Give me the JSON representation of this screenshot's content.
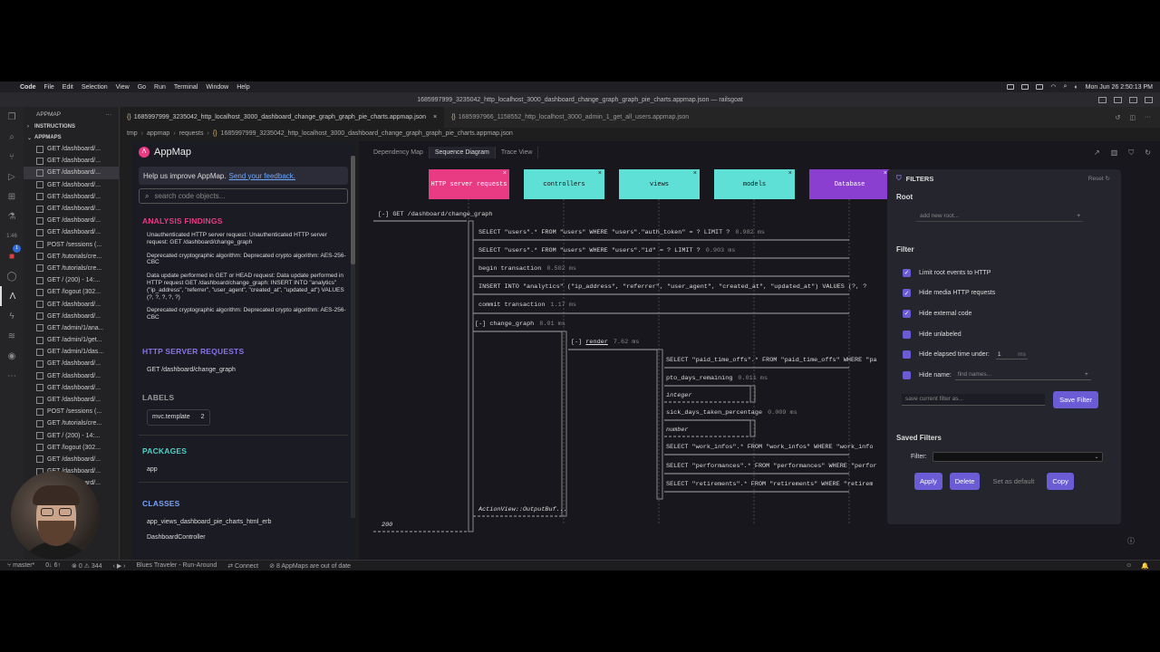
{
  "menubar": {
    "app": "Code",
    "items": [
      "File",
      "Edit",
      "Selection",
      "View",
      "Go",
      "Run",
      "Terminal",
      "Window",
      "Help"
    ],
    "clock": "Mon Jun 26  2:50:13 PM"
  },
  "window_title": "1685997999_3235042_http_localhost_3000_dashboard_change_graph_graph_pie_charts.appmap.json — railsgoat",
  "explorer": {
    "header": "APPMAP",
    "sections": [
      "INSTRUCTIONS",
      "APPMAPS"
    ],
    "items": [
      "GET /dashboard/...",
      "GET /dashboard/...",
      "GET /dashboard/...",
      "GET /dashboard/...",
      "GET /dashboard/...",
      "GET /dashboard/...",
      "GET /dashboard/...",
      "GET /dashboard/...",
      "POST /sessions (...",
      "GET /tutorials/cre...",
      "GET /tutorials/cre...",
      "GET / (200) - 14:...",
      "GET /logout (302...",
      "GET /dashboard/...",
      "GET /dashboard/...",
      "GET /admin/1/ana...",
      "GET /admin/1/get...",
      "GET /admin/1/das...",
      "GET /dashboard/...",
      "GET /dashboard/...",
      "GET /dashboard/...",
      "GET /dashboard/...",
      "POST /sessions (...",
      "GET /tutorials/cre...",
      "GET / (200) - 14:...",
      "GET /logout (302...",
      "GET /dashboard/...",
      "GET /dashboard/...",
      "GET /dashboard/..."
    ],
    "selected_index": 2
  },
  "activity": {
    "time_badge": "1:46",
    "badge_count": "1"
  },
  "tabs": [
    {
      "label": "1685997999_3235042_http_localhost_3000_dashboard_change_graph_graph_pie_charts.appmap.json",
      "active": true
    },
    {
      "label": "1685997966_1158552_http_localhost_3000_admin_1_get_all_users.appmap.json",
      "active": false
    }
  ],
  "breadcrumb": [
    "tmp",
    "appmap",
    "requests",
    "1685997999_3235042_http_localhost_3000_dashboard_change_graph_graph_pie_charts.appmap.json"
  ],
  "appmap_left": {
    "title": "AppMap",
    "improve_text": "Help us improve AppMap.",
    "improve_link": "Send your feedback.",
    "search_placeholder": "search code objects...",
    "analysis_header": "ANALYSIS FINDINGS",
    "findings": [
      "Unauthenticated HTTP server request: Unauthenticated HTTP server request: GET /dashboard/change_graph",
      "Deprecated cryptographic algorithm: Deprecated crypto algorithm: AES-256-CBC",
      "Data update performed in GET or HEAD request: Data update performed in HTTP request GET /dashboard/change_graph: INSERT INTO \"analytics\" (\"ip_address\", \"referrer\", \"user_agent\", \"created_at\", \"updated_at\") VALUES (?, ?, ?, ?, ?)",
      "Deprecated cryptographic algorithm: Deprecated crypto algorithm: AES-256-CBC"
    ],
    "http_header": "HTTP SERVER REQUESTS",
    "http_item": "GET /dashboard/change_graph",
    "labels_header": "LABELS",
    "label_name": "mvc.template",
    "label_count": "2",
    "packages_header": "PACKAGES",
    "package_item": "app",
    "classes_header": "CLASSES",
    "class_items": [
      "app_views_dashboard_pie_charts_html_erb",
      "DashboardController"
    ]
  },
  "subtabs": [
    "Dependency Map",
    "Sequence Diagram",
    "Trace View"
  ],
  "active_subtab": "Sequence Diagram",
  "actors": [
    {
      "label": "HTTP server requests",
      "color": "#e93a84"
    },
    {
      "label": "controllers",
      "color": "#5fe0d6"
    },
    {
      "label": "views",
      "color": "#5fe0d6"
    },
    {
      "label": "models",
      "color": "#5fe0d6"
    },
    {
      "label": "Database",
      "color": "#8a3fd0"
    }
  ],
  "sequence": {
    "root": "[-] GET /dashboard/change_graph",
    "messages": [
      {
        "text": "SELECT \"users\".* FROM \"users\" WHERE \"users\".\"auth_token\" = ? LIMIT ?",
        "time": "0.982 ms"
      },
      {
        "text": "SELECT \"users\".* FROM \"users\" WHERE \"users\".\"id\" = ? LIMIT ?",
        "time": "0.903 ms"
      },
      {
        "text": "begin transaction",
        "time": "0.502 ms"
      },
      {
        "text": "INSERT INTO \"analytics\" (\"ip_address\", \"referrer\", \"user_agent\", \"created_at\", \"updated_at\") VALUES (?, ?",
        "time": ""
      },
      {
        "text": "commit transaction",
        "time": "1.17 ms"
      }
    ],
    "change_graph": "[-] change_graph",
    "change_graph_time": "8.01 ms",
    "render_prefix": "[-]",
    "render_label": "render",
    "render_time": "7.62 ms",
    "view_msgs": [
      {
        "text": "SELECT \"paid_time_offs\".* FROM \"paid_time_offs\" WHERE \"pa",
        "time": ""
      },
      {
        "text": "pto_days_remaining",
        "time": "0.011 ms"
      },
      {
        "text": "integer",
        "time": ""
      },
      {
        "text": "sick_days_taken_percentage",
        "time": "0.009 ms"
      },
      {
        "text": "number",
        "time": ""
      },
      {
        "text": "SELECT \"work_infos\".* FROM \"work_infos\" WHERE \"work_info",
        "time": ""
      },
      {
        "text": "SELECT \"performances\".* FROM \"performances\" WHERE \"perfor",
        "time": ""
      },
      {
        "text": "SELECT \"retirements\".* FROM \"retirements\" WHERE \"retirem",
        "time": ""
      }
    ],
    "return_output": "ActionView::OutputBuf...",
    "status": "200"
  },
  "filters": {
    "title": "FILTERS",
    "reset": "Reset",
    "root_title": "Root",
    "root_placeholder": "add new root...",
    "filter_title": "Filter",
    "options": [
      {
        "label": "Limit root events to HTTP",
        "checked": true
      },
      {
        "label": "Hide media HTTP requests",
        "checked": true
      },
      {
        "label": "Hide external code",
        "checked": true
      },
      {
        "label": "Hide unlabeled",
        "checked": false
      },
      {
        "label": "Hide elapsed time under:",
        "checked": false
      },
      {
        "label": "Hide name:",
        "checked": false
      }
    ],
    "elapsed_value": "1",
    "elapsed_unit": "ms",
    "name_placeholder": "find names...",
    "save_placeholder": "save current filter as...",
    "save_button": "Save Filter",
    "saved_title": "Saved Filters",
    "filter_select_label": "Filter:",
    "apply": "Apply",
    "delete": "Delete",
    "set_default": "Set as default",
    "copy": "Copy"
  },
  "statusbar": {
    "branch": "master*",
    "sync": "0↓ 6↑",
    "problems": "⊗ 0 ⚠ 344",
    "track": "Blues Traveler - Run-Around",
    "connect": "Connect",
    "appmaps": "8 AppMaps are out of date"
  }
}
